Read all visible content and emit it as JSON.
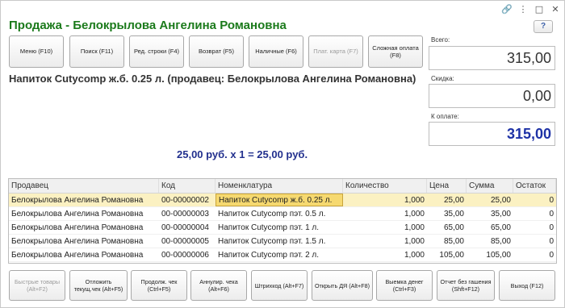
{
  "window": {
    "title": "Продажа - Белокрылова Ангелина Романовна",
    "help_label": "?",
    "controls": {
      "link": "🔗",
      "more": "⋮",
      "maximize": "□",
      "close": "✕"
    }
  },
  "top_buttons": [
    {
      "label": "Меню (F10)",
      "enabled": true
    },
    {
      "label": "Поиск (F11)",
      "enabled": true
    },
    {
      "label": "Ред. строки (F4)",
      "enabled": true
    },
    {
      "label": "Возврат (F5)",
      "enabled": true
    },
    {
      "label": "Наличные (F6)",
      "enabled": true
    },
    {
      "label": "Плат. карта (F7)",
      "enabled": false
    },
    {
      "label": "Сложная оплата (F8)",
      "enabled": true
    }
  ],
  "product": {
    "name": "Напиток Cutycomp ж.б. 0.25 л. (продавец: Белокрылова Ангелина Романовна)",
    "price_line": "25,00 руб. х 1  = 25,00 руб."
  },
  "totals": {
    "total_label": "Всего:",
    "total_value": "315,00",
    "discount_label": "Скидка:",
    "discount_value": "0,00",
    "to_pay_label": "К оплате:",
    "to_pay_value": "315,00"
  },
  "table": {
    "columns": [
      "Продавец",
      "Код",
      "Номенклатура",
      "Количество",
      "Цена",
      "Сумма",
      "Остаток"
    ],
    "rows": [
      [
        "Белокрылова Ангелина Романовна",
        "00-00000002",
        "Напиток Cutycomp ж.б. 0.25 л.",
        "1,000",
        "25,00",
        "25,00",
        "0"
      ],
      [
        "Белокрылова Ангелина Романовна",
        "00-00000003",
        "Напиток Cutycomp пэт. 0.5 л.",
        "1,000",
        "35,00",
        "35,00",
        "0"
      ],
      [
        "Белокрылова Ангелина Романовна",
        "00-00000004",
        "Напиток Cutycomp пэт. 1 л.",
        "1,000",
        "65,00",
        "65,00",
        "0"
      ],
      [
        "Белокрылова Ангелина Романовна",
        "00-00000005",
        "Напиток Cutycomp пэт. 1.5 л.",
        "1,000",
        "85,00",
        "85,00",
        "0"
      ],
      [
        "Белокрылова Ангелина Романовна",
        "00-00000006",
        "Напиток Cutycomp пэт. 2 л.",
        "1,000",
        "105,00",
        "105,00",
        "0"
      ]
    ],
    "selected_row": 0
  },
  "bottom_buttons": [
    {
      "label": "Быстрые товары (Alt+F2)",
      "enabled": false
    },
    {
      "label": "Отложить текущ.чек (Alt+F5)",
      "enabled": true
    },
    {
      "label": "Продолж. чек (Ctrl+F5)",
      "enabled": true
    },
    {
      "label": "Аннулир. чека (Alt+F6)",
      "enabled": true
    },
    {
      "label": "Штрихкод (Alt+F7)",
      "enabled": true
    },
    {
      "label": "Открыть ДЯ (Alt+F8)",
      "enabled": true
    },
    {
      "label": "Выемка денег (Ctrl+F3)",
      "enabled": true
    },
    {
      "label": "Отчет без гашения (Shft+F12)",
      "enabled": true
    },
    {
      "label": "Выход (F12)",
      "enabled": true
    }
  ]
}
